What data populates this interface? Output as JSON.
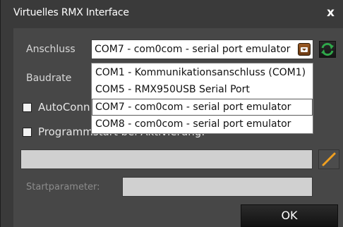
{
  "window": {
    "title": "Virtuelles RMX Interface",
    "close_glyph": "x"
  },
  "labels": {
    "anschluss": "Anschluss",
    "baudrate": "Baudrate",
    "autoconnect": "AutoConn",
    "programmstart": "Programmstart bei Aktivierung:",
    "startparameter": "Startparameter:"
  },
  "port_combo": {
    "selected": "COM7 - com0com - serial port emulator",
    "expanded": true
  },
  "port_options": [
    "COM1 -  Kommunikationsanschluss (COM1)",
    "COM5 - RMX950USB Serial Port",
    "COM7 - com0com - serial port emulator",
    "COM8 - com0com - serial port emulator"
  ],
  "checkboxes": {
    "autoconnect_checked": false,
    "programmstart_checked": false
  },
  "fields": {
    "program_path": "",
    "startparameter": ""
  },
  "buttons": {
    "ok": "OK"
  },
  "icons": {
    "dropdown": "chevron-down-icon",
    "refresh": "refresh-icon",
    "edit": "pencil-icon"
  },
  "colors": {
    "background": "#474747",
    "titlebar": "#3a3a3a",
    "refresh_green": "#2fa84a",
    "pencil_orange": "#f0a020",
    "dropdown_arrow": "#8a4d1c"
  }
}
